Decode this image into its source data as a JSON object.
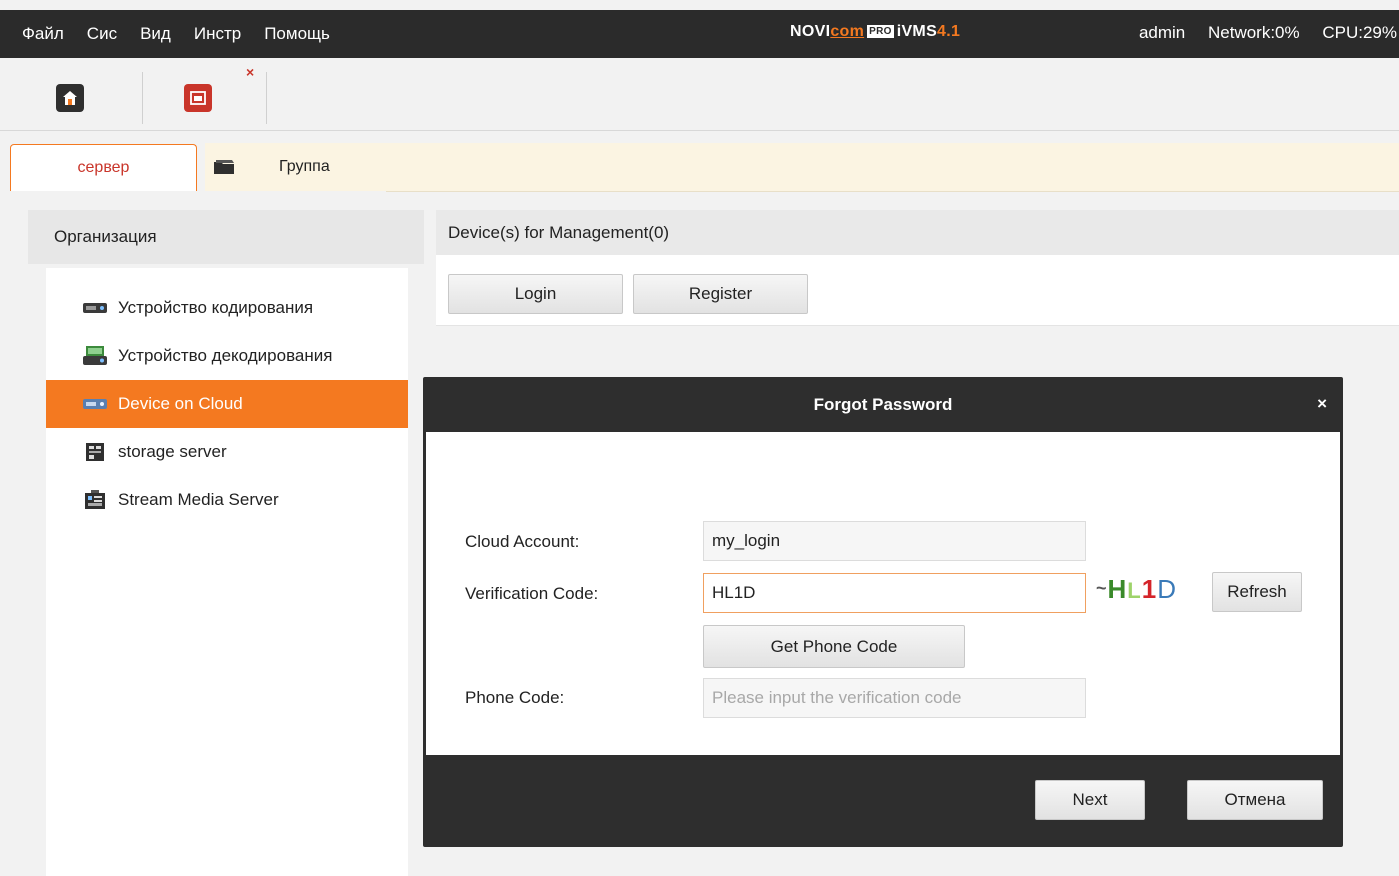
{
  "menu": {
    "items": [
      "Файл",
      "Сис",
      "Вид",
      "Инстр",
      "Помощь"
    ]
  },
  "brand": {
    "part1": "NOVI",
    "part2": "com",
    "pro": "PRO",
    "product": "iVMS",
    "version": "4.1"
  },
  "status": {
    "user": "admin",
    "network": "Network:0%",
    "cpu": "CPU:29%"
  },
  "toolbar": {
    "close_glyph": "×"
  },
  "tabs": {
    "server": "сервер",
    "group": "Группа"
  },
  "left": {
    "header": "Организация",
    "items": [
      {
        "label": "Устройство кодирования",
        "icon": "encoder-device-icon"
      },
      {
        "label": "Устройство декодирования",
        "icon": "decoder-device-icon"
      },
      {
        "label": "Device on Cloud",
        "icon": "cloud-device-icon",
        "selected": true
      },
      {
        "label": "storage server",
        "icon": "storage-server-icon"
      },
      {
        "label": "Stream Media Server",
        "icon": "stream-media-server-icon"
      }
    ]
  },
  "right": {
    "header": "Device(s) for Management(0)",
    "login_label": "Login",
    "register_label": "Register"
  },
  "dialog": {
    "title": "Forgot Password",
    "close_glyph": "×",
    "cloud_account_label": "Cloud Account:",
    "cloud_account_value": "my_login",
    "verification_label": "Verification Code:",
    "verification_value": "HL1D",
    "captcha_text": "HL1D",
    "refresh_label": "Refresh",
    "get_phone_code_label": "Get Phone Code",
    "phone_code_label": "Phone Code:",
    "phone_code_placeholder": "Please input the verification code",
    "next_label": "Next",
    "cancel_label": "Отмена"
  },
  "colors": {
    "accent": "#f47920",
    "dark_bar": "#2b2b2b",
    "dialog_bg": "#2e2e2e"
  }
}
